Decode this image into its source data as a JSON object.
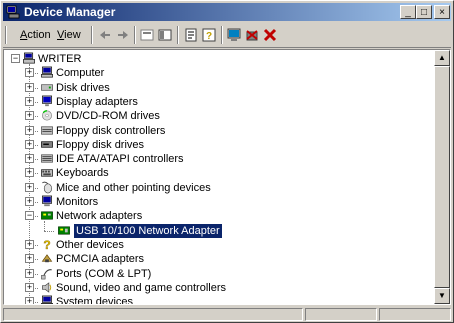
{
  "window": {
    "title": "Device Manager"
  },
  "menu": {
    "action": "Action",
    "view": "View"
  },
  "controls": {
    "minimize": "_",
    "maximize": "□",
    "close": "×"
  },
  "tree": {
    "root": "WRITER",
    "categories": [
      {
        "label": "Computer",
        "icon": "computer-icon"
      },
      {
        "label": "Disk drives",
        "icon": "disk-drive-icon"
      },
      {
        "label": "Display adapters",
        "icon": "display-adapter-icon"
      },
      {
        "label": "DVD/CD-ROM drives",
        "icon": "cdrom-icon"
      },
      {
        "label": "Floppy disk controllers",
        "icon": "floppy-controller-icon"
      },
      {
        "label": "Floppy disk drives",
        "icon": "floppy-drive-icon"
      },
      {
        "label": "IDE ATA/ATAPI controllers",
        "icon": "ide-controller-icon"
      },
      {
        "label": "Keyboards",
        "icon": "keyboard-icon"
      },
      {
        "label": "Mice and other pointing devices",
        "icon": "mouse-icon"
      },
      {
        "label": "Monitors",
        "icon": "monitor-icon"
      },
      {
        "label": "Network adapters",
        "icon": "network-adapter-icon",
        "expanded": true
      },
      {
        "label": "USB 10/100 Network Adapter",
        "icon": "network-card-icon",
        "child": true,
        "selected": true
      },
      {
        "label": "Other devices",
        "icon": "unknown-device-icon"
      },
      {
        "label": "PCMCIA adapters",
        "icon": "pcmcia-icon"
      },
      {
        "label": "Ports (COM & LPT)",
        "icon": "port-icon"
      },
      {
        "label": "Sound, video and game controllers",
        "icon": "sound-icon"
      },
      {
        "label": "System devices",
        "icon": "system-device-icon"
      }
    ]
  },
  "colors": {
    "title_start": "#0a246a",
    "title_end": "#a6caf0",
    "selection": "#0a246a"
  }
}
